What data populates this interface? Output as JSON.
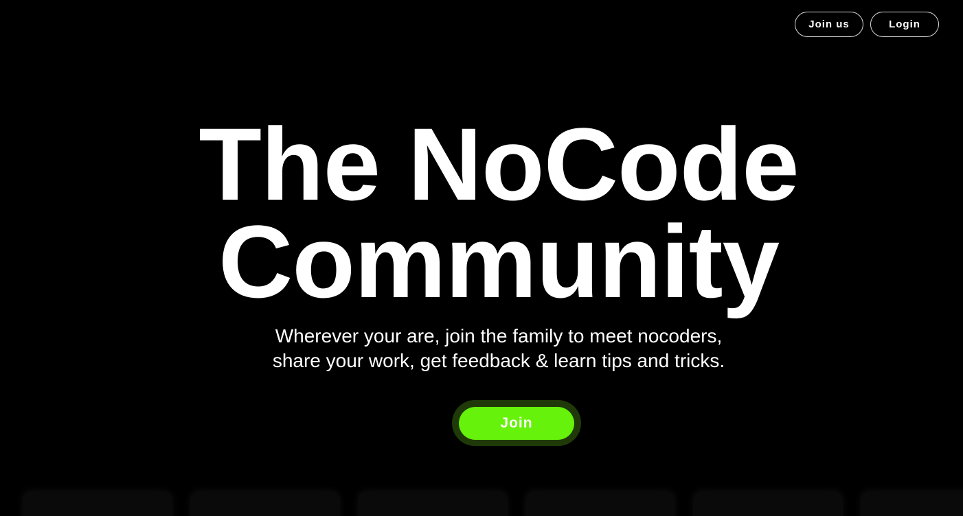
{
  "nav": {
    "join_us_label": "Join us",
    "login_label": "Login"
  },
  "hero": {
    "title_line1": "The NoCode",
    "title_line2": "Community",
    "subtitle_line1": "Wherever your are, join the family to meet nocoders,",
    "subtitle_line2": "share your work, get feedback & learn tips and tricks.",
    "cta_label": "Join"
  },
  "colors": {
    "background": "#000000",
    "accent": "#66f20a",
    "accent_glow": "#1f3a08",
    "text": "#ffffff"
  },
  "cards": [
    {
      "id": 1
    },
    {
      "id": 2
    },
    {
      "id": 3
    },
    {
      "id": 4
    },
    {
      "id": 5
    },
    {
      "id": 6
    }
  ]
}
